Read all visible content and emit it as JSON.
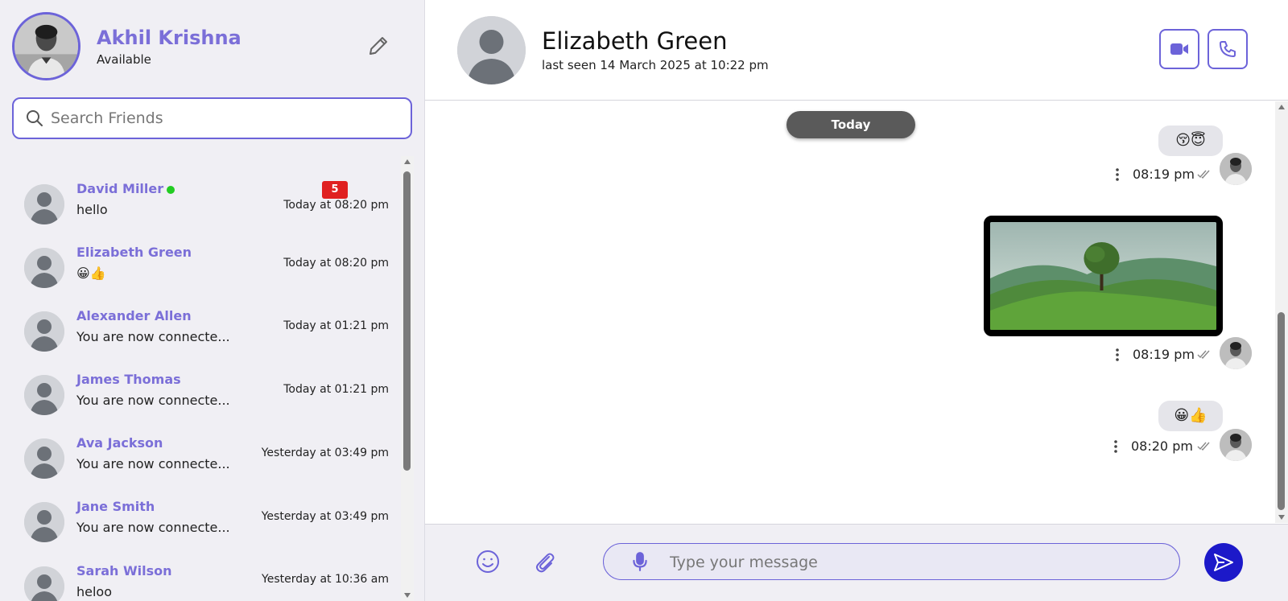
{
  "colors": {
    "accent": "#6c63d9",
    "name_purple": "#7b6fd8",
    "sidebar_bg": "#f0eff4",
    "unread_red": "#e02020",
    "online_green": "#22cc22",
    "send_blue": "#1c19c9"
  },
  "profile": {
    "name": "Akhil Krishna",
    "status": "Available",
    "edit_icon": "pencil-icon"
  },
  "search": {
    "placeholder": "Search Friends",
    "icon": "search-icon"
  },
  "contacts": [
    {
      "name": "David Miller",
      "last_message": "hello",
      "time": "Today at 08:20 pm",
      "online": true,
      "unread": "5"
    },
    {
      "name": "Elizabeth Green",
      "last_message": "😀👍",
      "time": "Today at 08:20 pm"
    },
    {
      "name": "Alexander Allen",
      "last_message": "You are now connecte...",
      "time": "Today at 01:21 pm"
    },
    {
      "name": "James Thomas",
      "last_message": "You are now connecte...",
      "time": "Today at 01:21 pm"
    },
    {
      "name": "Ava Jackson",
      "last_message": "You are now connecte...",
      "time": "Yesterday at 03:49 pm"
    },
    {
      "name": "Jane Smith",
      "last_message": "You are now connecte...",
      "time": "Yesterday at 03:49 pm"
    },
    {
      "name": "Sarah Wilson",
      "last_message": "heloo",
      "time": "Yesterday at 10:36 am"
    }
  ],
  "chat": {
    "name": "Elizabeth Green",
    "last_seen": "last seen 14 March 2025 at 10:22 pm",
    "video_icon": "video-camera-icon",
    "call_icon": "phone-icon",
    "date_divider": "Today",
    "messages": [
      {
        "type": "text",
        "content": "😚😇",
        "time": "08:19 pm"
      },
      {
        "type": "image",
        "content": "landscape-tree-image",
        "time": "08:19 pm"
      },
      {
        "type": "text",
        "content": "😀👍",
        "time": "08:20 pm"
      }
    ]
  },
  "composer": {
    "placeholder": "Type your message",
    "emoji_icon": "smiley-icon",
    "attach_icon": "paperclip-icon",
    "mic_icon": "microphone-icon",
    "send_icon": "send-icon"
  }
}
